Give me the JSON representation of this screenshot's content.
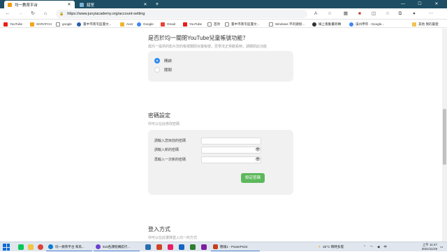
{
  "browser": {
    "tabs": [
      {
        "title": "均一教育平台",
        "active": true
      },
      {
        "title": "錯室",
        "active": false
      }
    ],
    "new_tab": "+",
    "window_controls": [
      "—",
      "☐",
      "✕"
    ],
    "url": "https://www.junyiacademy.org/account-setting",
    "bookmarks": [
      {
        "label": "YouTube",
        "color": "#e62117"
      },
      {
        "label": "SCRATCH",
        "color": "#f7a21b"
      },
      {
        "label": "google",
        "color": "#ffffff"
      },
      {
        "label": "臺中市南屯區臺文...",
        "color": "#2a5caa"
      },
      {
        "label": "Acer",
        "color": "#f2b530"
      },
      {
        "label": "Google",
        "color": "#4285f4"
      },
      {
        "label": "Gmail",
        "color": "#ea4335"
      },
      {
        "label": "YouTube",
        "color": "#e62117"
      },
      {
        "label": "首頁",
        "color": "#ffffff"
      },
      {
        "label": "臺中市南屯區臺文...",
        "color": "#ffffff"
      },
      {
        "label": "Windows 平的鏈接...",
        "color": "#ffffff"
      },
      {
        "label": "線上看動畫跨轉",
        "color": "#333333"
      },
      {
        "label": "溪州學年 - Google...",
        "color": "#4285f4"
      }
    ],
    "other_bookmarks": "其他 我的最愛"
  },
  "youtube_kids": {
    "title": "是否於均一關閉YouTube兒童帳號功能？",
    "subtitle": "需均一提供的影片您的帳號關閉兒童帳號，否學法正常觀看時，請關閉此功能",
    "options": [
      {
        "label": "開啟",
        "selected": true
      },
      {
        "label": "關閉",
        "selected": false
      }
    ]
  },
  "password": {
    "title": "密碼設定",
    "subtitle": "你可以在此修改密碼",
    "fields": [
      {
        "label": "請輸入您目前的密碼",
        "placeholder": "",
        "has_eye": false
      },
      {
        "label": "請輸入新的密碼",
        "placeholder": "",
        "has_eye": true
      },
      {
        "label": "再輸入一次新的密碼",
        "placeholder": "",
        "has_eye": true
      }
    ],
    "submit_label": "設定密碼"
  },
  "login": {
    "title": "登入方式",
    "subtitle": "你可以在此選擇登入均一的方式"
  },
  "taskbar": {
    "windows": [
      {
        "label": "均一教育平台 和鳥...",
        "color": "#0c7bd1"
      },
      {
        "label": "515各課程構成代...",
        "color": "#6b3fd1"
      },
      {
        "label": "簡報1 - PowerPoint",
        "color": "#c43e1c"
      }
    ],
    "weather": "25°C  晴時多雲",
    "ime": "中",
    "time": "上午 11:47",
    "date": "2021/11/19"
  },
  "colors": {
    "tab_strip": "#1d4e63",
    "radio_selected": "#2d8cf0",
    "submit_button": "#5cb85c"
  }
}
